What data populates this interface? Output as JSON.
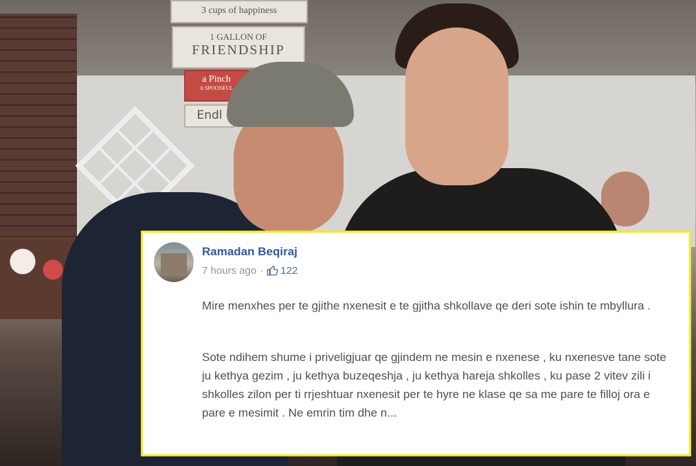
{
  "post": {
    "author": "Ramadan Beqiraj",
    "time": "7 hours ago",
    "separator": "·",
    "likes": "122",
    "paragraph1": "Mire menxhes per te gjithe nxenesit e te gjitha shkollave qe deri sote ishin te mbyllura .",
    "paragraph2": "Sote ndihem shume i priveligjuar qe gjindem ne mesin e nxenese , ku nxenesve tane sote ju kethya gezim , ju kethya buzeqeshja , ju kethya hareja shkolles , ku pase 2 vitev zili i shkolles zilon per ti rrjeshtuar nxenesit per te hyre ne klase qe sa me pare te filloj ora e pare e mesimit . Ne emrin tim dhe n..."
  },
  "signs": {
    "top": "3 cups of happiness",
    "gallon": "1 GALLON OF",
    "friendship": "FRIENDSHIP",
    "pinch": "a Pinch",
    "spoonful": "A SPOONFUL",
    "endless": "Endl"
  },
  "colors": {
    "highlight_border": "#f5ea1a",
    "author_link": "#365899",
    "meta_text": "#90949c",
    "body_text": "#4b4f56"
  },
  "icons": {
    "like": "thumbs-up-icon"
  }
}
